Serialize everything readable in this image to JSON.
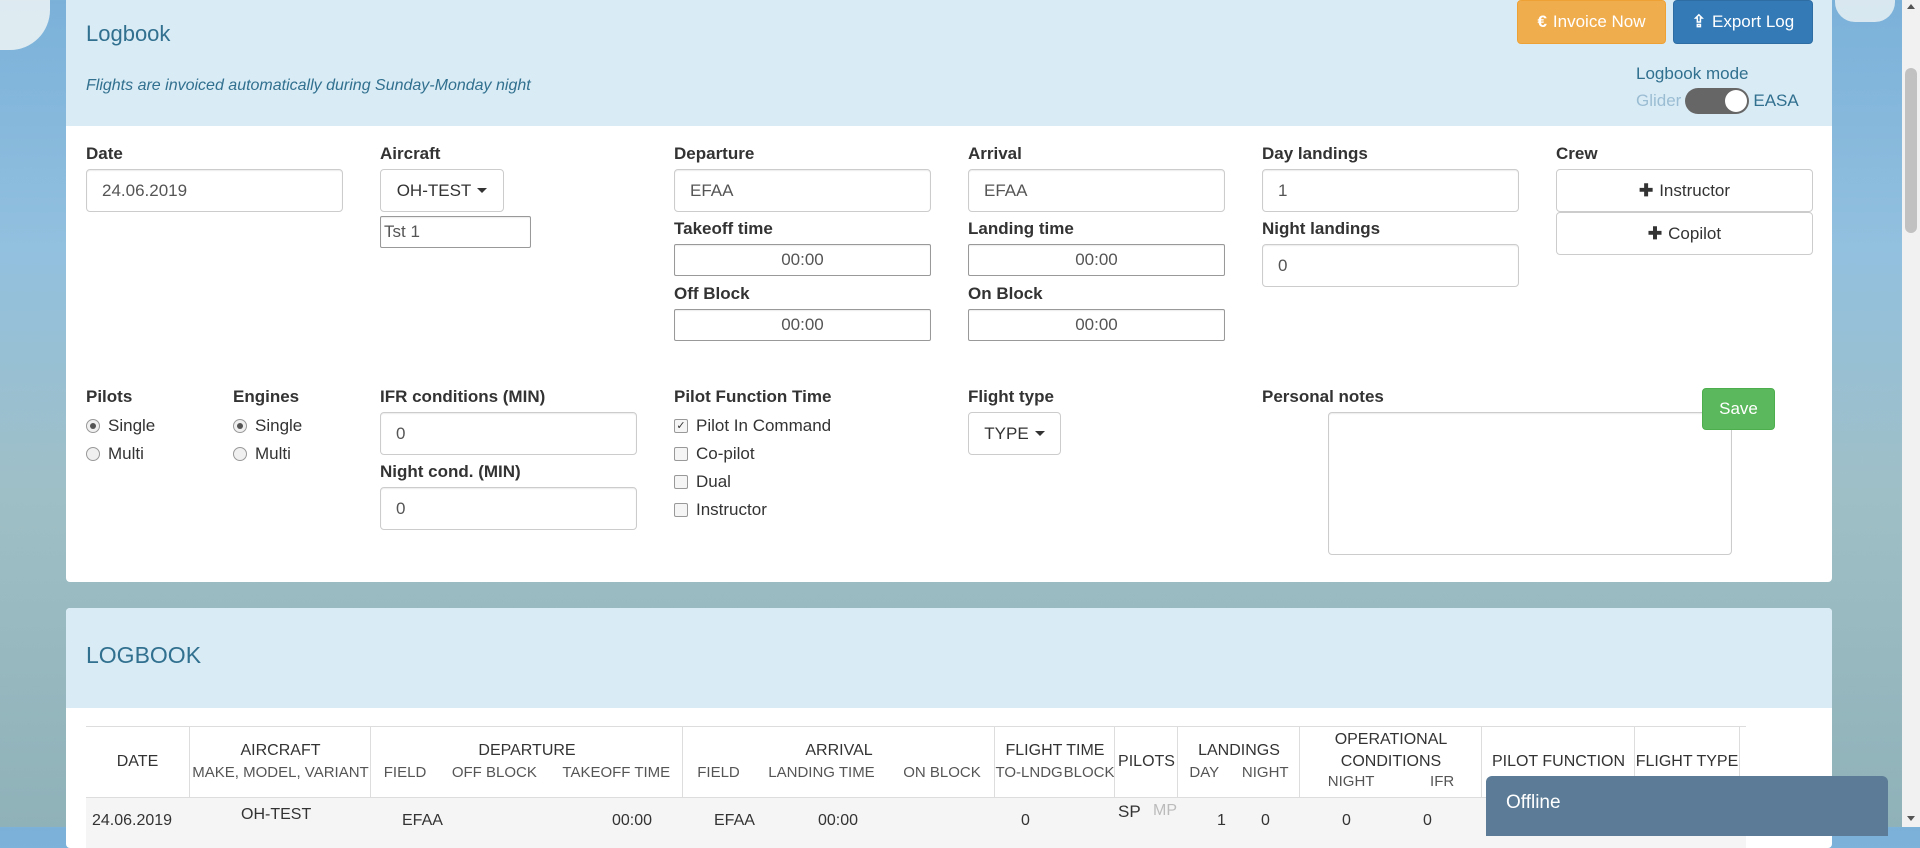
{
  "form_panel": {
    "title": "Logbook",
    "note": "Flights are invoiced automatically during Sunday-Monday night",
    "invoice_button": "Invoice Now",
    "export_button": "Export Log",
    "mode_label": "Logbook mode",
    "mode_off": "Glider",
    "mode_on": "EASA",
    "mode_value": "EASA"
  },
  "fields": {
    "date": {
      "label": "Date",
      "value": "24.06.2019"
    },
    "aircraft": {
      "label": "Aircraft",
      "selected": "OH-TEST",
      "sub_value": "Tst 1"
    },
    "departure": {
      "label": "Departure",
      "value": "EFAA"
    },
    "takeoff_time": {
      "label": "Takeoff time",
      "value": "00:00"
    },
    "off_block": {
      "label": "Off Block",
      "value": "00:00"
    },
    "arrival": {
      "label": "Arrival",
      "value": "EFAA"
    },
    "landing_time": {
      "label": "Landing time",
      "value": "00:00"
    },
    "on_block": {
      "label": "On Block",
      "value": "00:00"
    },
    "day_landings": {
      "label": "Day landings",
      "value": "1"
    },
    "night_landings": {
      "label": "Night landings",
      "value": "0"
    },
    "crew": {
      "label": "Crew",
      "instructor_button": "Instructor",
      "copilot_button": "Copilot"
    },
    "pilots": {
      "label": "Pilots",
      "options": [
        "Single",
        "Multi"
      ],
      "selected": "Single"
    },
    "engines": {
      "label": "Engines",
      "options": [
        "Single",
        "Multi"
      ],
      "selected": "Single"
    },
    "ifr": {
      "label": "IFR conditions (MIN)",
      "value": "0"
    },
    "night_cond": {
      "label": "Night cond. (MIN)",
      "value": "0"
    },
    "pilot_function": {
      "label": "Pilot Function Time",
      "options": [
        {
          "label": "Pilot In Command",
          "checked": true
        },
        {
          "label": "Co-pilot",
          "checked": false
        },
        {
          "label": "Dual",
          "checked": false
        },
        {
          "label": "Instructor",
          "checked": false
        }
      ]
    },
    "flight_type": {
      "label": "Flight type",
      "selected": "TYPE"
    },
    "personal_notes": {
      "label": "Personal notes",
      "value": ""
    },
    "save_button": "Save"
  },
  "logbook_panel": {
    "title": "LOGBOOK",
    "columns": {
      "date": "DATE",
      "aircraft": "AIRCRAFT",
      "aircraft_sub": "MAKE, MODEL, VARIANT",
      "departure": "DEPARTURE",
      "departure_sub": [
        "FIELD",
        "OFF BLOCK",
        "TAKEOFF TIME"
      ],
      "arrival": "ARRIVAL",
      "arrival_sub": [
        "FIELD",
        "LANDING TIME",
        "ON BLOCK"
      ],
      "flight_time": "FLIGHT TIME",
      "flight_time_sub": [
        "TO-LNDG",
        "BLOCK"
      ],
      "pilots": "PILOTS",
      "landings": "LANDINGS",
      "landings_sub": [
        "DAY",
        "NIGHT"
      ],
      "operational": "OPERATIONAL CONDITIONS",
      "operational_sub": [
        "NIGHT",
        "IFR"
      ],
      "pilot_function": "PILOT FUNCTION",
      "flight_type": "FLIGHT TYPE"
    },
    "rows": [
      {
        "date": "24.06.2019",
        "aircraft": "OH-TEST",
        "dep_field": "EFAA",
        "takeoff_time": "00:00",
        "arr_field": "EFAA",
        "landing_time": "00:00",
        "to_lndg": "0",
        "pilots_sp": "SP",
        "pilots_mp": "MP",
        "day": "1",
        "night": "0",
        "op_night": "0",
        "op_ifr": "0"
      }
    ]
  },
  "chat": {
    "status": "Offline"
  }
}
